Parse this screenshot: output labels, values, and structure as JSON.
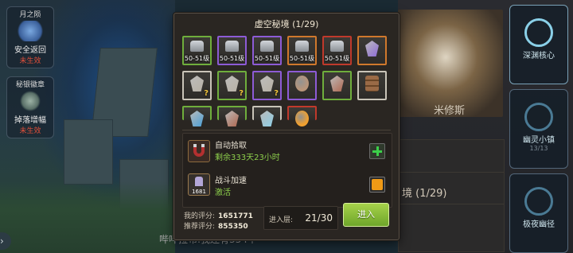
{
  "dialog": {
    "title": "虚空秘境 (1/29)",
    "rewards": [
      {
        "level": "50-51级",
        "border": "green",
        "icon": "armor-icon",
        "unknown": false
      },
      {
        "level": "50-51级",
        "border": "purple",
        "icon": "armor-icon",
        "unknown": false
      },
      {
        "level": "50-51级",
        "border": "purple",
        "icon": "armor-icon",
        "unknown": false
      },
      {
        "level": "50-51级",
        "border": "orange",
        "icon": "armor-icon",
        "unknown": false
      },
      {
        "level": "50-51级",
        "border": "red",
        "icon": "armor-icon",
        "unknown": false
      },
      {
        "level": "",
        "border": "orange",
        "icon": "purple-crystal-icon",
        "unknown": false
      },
      {
        "level": "",
        "border": "white",
        "icon": "crystal-icon",
        "unknown": true
      },
      {
        "level": "",
        "border": "green",
        "icon": "crystal-icon",
        "unknown": true
      },
      {
        "level": "",
        "border": "purple",
        "icon": "crystal-icon",
        "unknown": true
      },
      {
        "level": "",
        "border": "purple",
        "icon": "egg-icon",
        "unknown": false
      },
      {
        "level": "",
        "border": "green",
        "icon": "ore-icon",
        "unknown": false
      },
      {
        "level": "",
        "border": "white",
        "icon": "wood-logs-icon",
        "unknown": false
      },
      {
        "level": "",
        "border": "green",
        "icon": "blue-crystal-icon",
        "unknown": false
      },
      {
        "level": "",
        "border": "green",
        "icon": "ore-icon",
        "unknown": false
      },
      {
        "level": "",
        "border": "white",
        "icon": "ice-crystal-icon",
        "unknown": false
      },
      {
        "level": "",
        "border": "red",
        "icon": "fire-orb-icon",
        "unknown": false
      }
    ],
    "auto_pickup": {
      "label": "自动拾取",
      "value": "剩余333天23小时",
      "icon": "magnet-icon"
    },
    "battle_speed": {
      "label": "战斗加速",
      "value": "激活",
      "icon": "speed-icon",
      "badge": "1681"
    },
    "my_score_label": "我的评分:",
    "my_score": "1651771",
    "rec_score_label": "推荐评分:",
    "rec_score": "855350",
    "floor_label": "进入层:",
    "floor_value": "21/30",
    "enter_label": "进入"
  },
  "hud_left": [
    {
      "title": "月之陨",
      "line1": "安全返回",
      "line2": "未生效"
    },
    {
      "title": "秘银徽章",
      "line1": "掉落增幅",
      "line2": "未生效"
    }
  ],
  "hud_right": [
    {
      "label": "深渊核心",
      "sub": ""
    },
    {
      "label": "幽灵小镇",
      "sub": "13/13"
    },
    {
      "label": "极夜幽径",
      "sub": ""
    }
  ],
  "background": {
    "hero_name": "米修斯",
    "panel_text": "境 (1/29)"
  },
  "chat": {
    "text": "哔哔拉布:我还有334个"
  }
}
